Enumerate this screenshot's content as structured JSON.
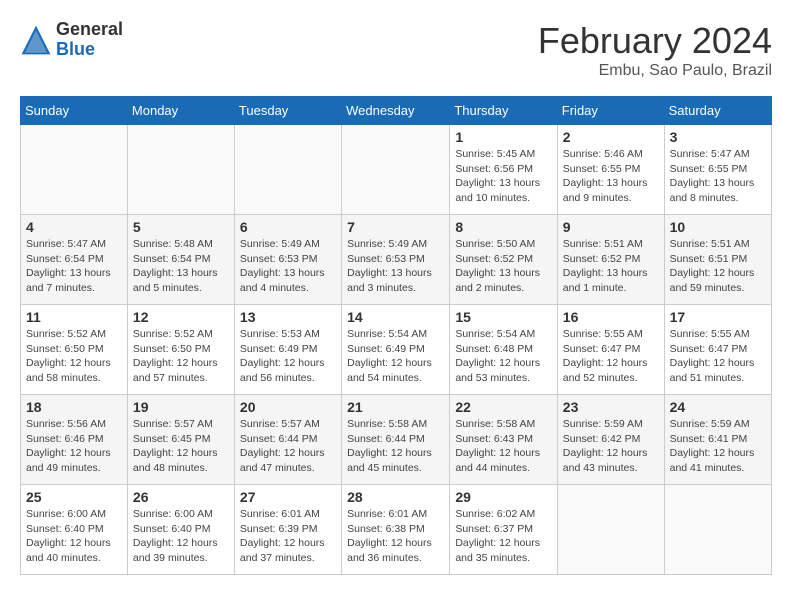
{
  "header": {
    "logo_general": "General",
    "logo_blue": "Blue",
    "month_title": "February 2024",
    "location": "Embu, Sao Paulo, Brazil"
  },
  "days_of_week": [
    "Sunday",
    "Monday",
    "Tuesday",
    "Wednesday",
    "Thursday",
    "Friday",
    "Saturday"
  ],
  "weeks": [
    [
      {
        "day": "",
        "info": ""
      },
      {
        "day": "",
        "info": ""
      },
      {
        "day": "",
        "info": ""
      },
      {
        "day": "",
        "info": ""
      },
      {
        "day": "1",
        "info": "Sunrise: 5:45 AM\nSunset: 6:56 PM\nDaylight: 13 hours\nand 10 minutes."
      },
      {
        "day": "2",
        "info": "Sunrise: 5:46 AM\nSunset: 6:55 PM\nDaylight: 13 hours\nand 9 minutes."
      },
      {
        "day": "3",
        "info": "Sunrise: 5:47 AM\nSunset: 6:55 PM\nDaylight: 13 hours\nand 8 minutes."
      }
    ],
    [
      {
        "day": "4",
        "info": "Sunrise: 5:47 AM\nSunset: 6:54 PM\nDaylight: 13 hours\nand 7 minutes."
      },
      {
        "day": "5",
        "info": "Sunrise: 5:48 AM\nSunset: 6:54 PM\nDaylight: 13 hours\nand 5 minutes."
      },
      {
        "day": "6",
        "info": "Sunrise: 5:49 AM\nSunset: 6:53 PM\nDaylight: 13 hours\nand 4 minutes."
      },
      {
        "day": "7",
        "info": "Sunrise: 5:49 AM\nSunset: 6:53 PM\nDaylight: 13 hours\nand 3 minutes."
      },
      {
        "day": "8",
        "info": "Sunrise: 5:50 AM\nSunset: 6:52 PM\nDaylight: 13 hours\nand 2 minutes."
      },
      {
        "day": "9",
        "info": "Sunrise: 5:51 AM\nSunset: 6:52 PM\nDaylight: 13 hours\nand 1 minute."
      },
      {
        "day": "10",
        "info": "Sunrise: 5:51 AM\nSunset: 6:51 PM\nDaylight: 12 hours\nand 59 minutes."
      }
    ],
    [
      {
        "day": "11",
        "info": "Sunrise: 5:52 AM\nSunset: 6:50 PM\nDaylight: 12 hours\nand 58 minutes."
      },
      {
        "day": "12",
        "info": "Sunrise: 5:52 AM\nSunset: 6:50 PM\nDaylight: 12 hours\nand 57 minutes."
      },
      {
        "day": "13",
        "info": "Sunrise: 5:53 AM\nSunset: 6:49 PM\nDaylight: 12 hours\nand 56 minutes."
      },
      {
        "day": "14",
        "info": "Sunrise: 5:54 AM\nSunset: 6:49 PM\nDaylight: 12 hours\nand 54 minutes."
      },
      {
        "day": "15",
        "info": "Sunrise: 5:54 AM\nSunset: 6:48 PM\nDaylight: 12 hours\nand 53 minutes."
      },
      {
        "day": "16",
        "info": "Sunrise: 5:55 AM\nSunset: 6:47 PM\nDaylight: 12 hours\nand 52 minutes."
      },
      {
        "day": "17",
        "info": "Sunrise: 5:55 AM\nSunset: 6:47 PM\nDaylight: 12 hours\nand 51 minutes."
      }
    ],
    [
      {
        "day": "18",
        "info": "Sunrise: 5:56 AM\nSunset: 6:46 PM\nDaylight: 12 hours\nand 49 minutes."
      },
      {
        "day": "19",
        "info": "Sunrise: 5:57 AM\nSunset: 6:45 PM\nDaylight: 12 hours\nand 48 minutes."
      },
      {
        "day": "20",
        "info": "Sunrise: 5:57 AM\nSunset: 6:44 PM\nDaylight: 12 hours\nand 47 minutes."
      },
      {
        "day": "21",
        "info": "Sunrise: 5:58 AM\nSunset: 6:44 PM\nDaylight: 12 hours\nand 45 minutes."
      },
      {
        "day": "22",
        "info": "Sunrise: 5:58 AM\nSunset: 6:43 PM\nDaylight: 12 hours\nand 44 minutes."
      },
      {
        "day": "23",
        "info": "Sunrise: 5:59 AM\nSunset: 6:42 PM\nDaylight: 12 hours\nand 43 minutes."
      },
      {
        "day": "24",
        "info": "Sunrise: 5:59 AM\nSunset: 6:41 PM\nDaylight: 12 hours\nand 41 minutes."
      }
    ],
    [
      {
        "day": "25",
        "info": "Sunrise: 6:00 AM\nSunset: 6:40 PM\nDaylight: 12 hours\nand 40 minutes."
      },
      {
        "day": "26",
        "info": "Sunrise: 6:00 AM\nSunset: 6:40 PM\nDaylight: 12 hours\nand 39 minutes."
      },
      {
        "day": "27",
        "info": "Sunrise: 6:01 AM\nSunset: 6:39 PM\nDaylight: 12 hours\nand 37 minutes."
      },
      {
        "day": "28",
        "info": "Sunrise: 6:01 AM\nSunset: 6:38 PM\nDaylight: 12 hours\nand 36 minutes."
      },
      {
        "day": "29",
        "info": "Sunrise: 6:02 AM\nSunset: 6:37 PM\nDaylight: 12 hours\nand 35 minutes."
      },
      {
        "day": "",
        "info": ""
      },
      {
        "day": "",
        "info": ""
      }
    ]
  ]
}
